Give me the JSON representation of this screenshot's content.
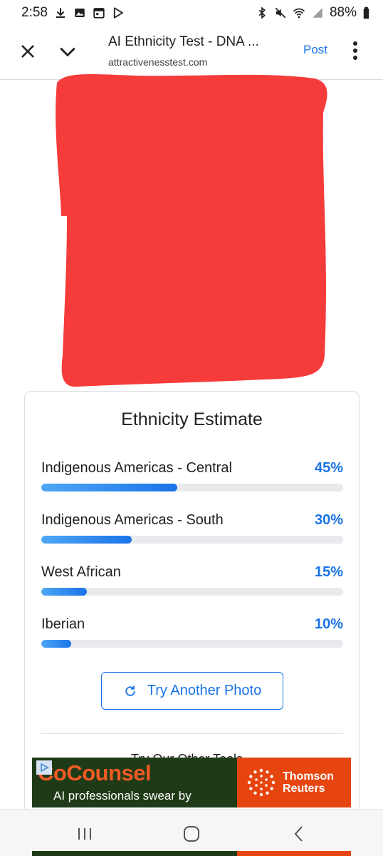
{
  "status_bar": {
    "time": "2:58",
    "battery": "88%"
  },
  "browser": {
    "title": "AI Ethnicity Test - DNA ...",
    "url": "attractivenesstest.com",
    "post_label": "Post"
  },
  "colors": {
    "accent": "#1a73e8",
    "redaction": "#f63b3b",
    "ad_green": "#1f3a17",
    "ad_orange": "#e6450f"
  },
  "card": {
    "title": "Ethnicity Estimate",
    "estimates": [
      {
        "label": "Indigenous Americas - Central",
        "percent_text": "45%",
        "value": 45
      },
      {
        "label": "Indigenous Americas - South",
        "percent_text": "30%",
        "value": 30
      },
      {
        "label": "West African",
        "percent_text": "15%",
        "value": 15
      },
      {
        "label": "Iberian",
        "percent_text": "10%",
        "value": 10
      }
    ],
    "retry_label": "Try Another Photo",
    "next_heading_partial": "Try Our Other Tools"
  },
  "ad": {
    "brand": "CoCounsel",
    "tagline": "AI professionals swear by",
    "sponsor_line1": "Thomson",
    "sponsor_line2": "Reuters"
  },
  "icons": [
    "download-icon",
    "image-icon",
    "calendar-icon",
    "play-store-icon",
    "bluetooth-icon",
    "mute-icon",
    "wifi-icon",
    "signal-icon",
    "battery-icon",
    "close-icon",
    "chevron-down-icon",
    "more-vert-icon",
    "refresh-icon",
    "ad-choices-icon",
    "recents-icon",
    "home-icon",
    "back-icon"
  ]
}
